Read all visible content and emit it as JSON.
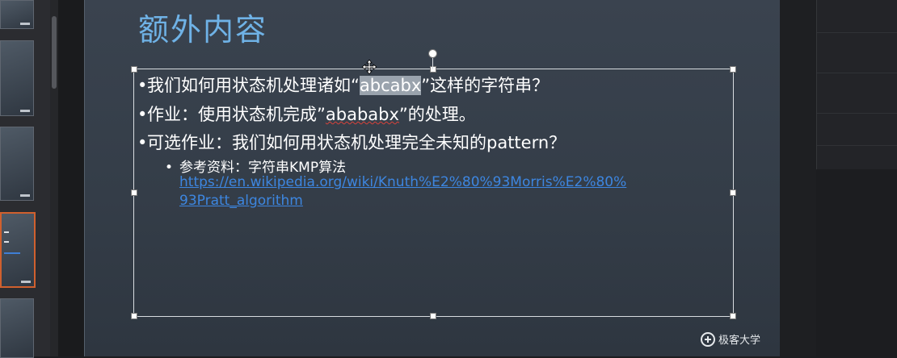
{
  "slide": {
    "title": "额外内容",
    "bullets": [
      {
        "before": "我们如何用状态机处理诸如“",
        "highlight": "abcabx",
        "after": "”这样的字符串？"
      },
      {
        "before": "作业：使用状态机完成”",
        "squiggle": "abababx",
        "after": "”的处理。"
      },
      {
        "text": "可选作业：我们如何用状态机处理完全未知的pattern？"
      }
    ],
    "sub_bullet": "参考资料：字符串KMP算法",
    "link_line1": "https://en.wikipedia.org/wiki/Knuth%E2%80%93Morris%E2%80%",
    "link_line2": "93Pratt_algorithm",
    "logo_text": "极客大学"
  },
  "colors": {
    "title": "#6fb2e6",
    "link": "#3d86e0",
    "selected_thumb_border": "#d0602e"
  }
}
